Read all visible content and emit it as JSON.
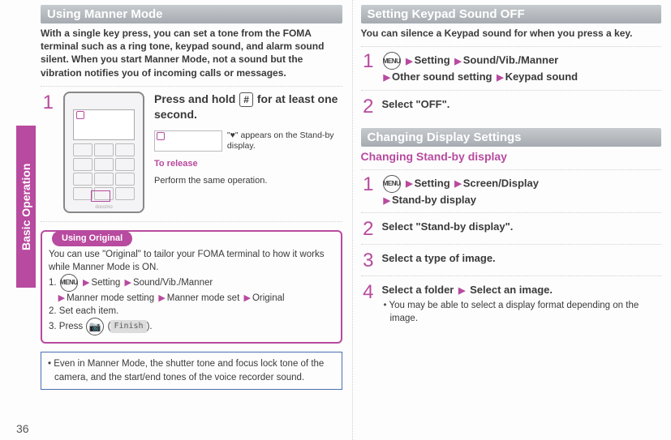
{
  "page_number": "36",
  "side_tab": "Basic Operation",
  "left": {
    "heading": "Using Manner Mode",
    "intro": "With a single key press, you can set a tone from the FOMA terminal such as a ring tone, keypad sound, and alarm sound silent. When you start Manner Mode, not a sound but the vibration notifies you of incoming calls or messages.",
    "step1_num": "1",
    "step1_text_a": "Press and hold ",
    "step1_text_b": " for at least one second.",
    "hash_key": "#",
    "indicator_icon": "♥",
    "appears_text": "\" appears on the Stand-by display.",
    "release_label": "To release",
    "release_text": "Perform the same operation.",
    "callout_tag": "Using Original",
    "callout_intro": "You can use \"Original\" to tailor your FOMA terminal to how it works while Manner Mode is ON.",
    "callout_1_lead": "1. ",
    "menu_label": "MENU",
    "camera_label": "📷",
    "finish_label": "Finish",
    "nav_setting": "Setting",
    "nav_sound": "Sound/Vib./Manner",
    "nav_mmsetting": "Manner mode setting",
    "nav_mmset": "Manner mode set",
    "nav_original": "Original",
    "callout_2": "2. Set each item.",
    "callout_3_a": "3. Press ",
    "callout_3_b": "(",
    "callout_3_c": ").",
    "notebox": "Even in Manner Mode, the shutter tone and focus lock tone of the camera, and the start/end tones of the voice recorder sound."
  },
  "right": {
    "heading1": "Setting Keypad Sound OFF",
    "intro1": "You can silence a Keypad sound for when you press a key.",
    "r1_s1_num": "1",
    "r1_s1_setting": "Setting",
    "r1_s1_sound": "Sound/Vib./Manner",
    "r1_s1_other": "Other sound setting",
    "r1_s1_keypad": "Keypad sound",
    "r1_s2_num": "2",
    "r1_s2_text": "Select \"OFF\".",
    "heading2": "Changing Display Settings",
    "subhead": "Changing Stand-by display",
    "r2_s1_num": "1",
    "r2_s1_setting": "Setting",
    "r2_s1_screen": "Screen/Display",
    "r2_s1_standby": "Stand-by display",
    "r2_s2_num": "2",
    "r2_s2_text": "Select \"Stand-by display\".",
    "r2_s3_num": "3",
    "r2_s3_text": "Select a type of image.",
    "r2_s4_num": "4",
    "r2_s4_a": "Select a folder",
    "r2_s4_b": "Select an image.",
    "r2_s4_note": "You may be able to select a display format depending on the image."
  }
}
